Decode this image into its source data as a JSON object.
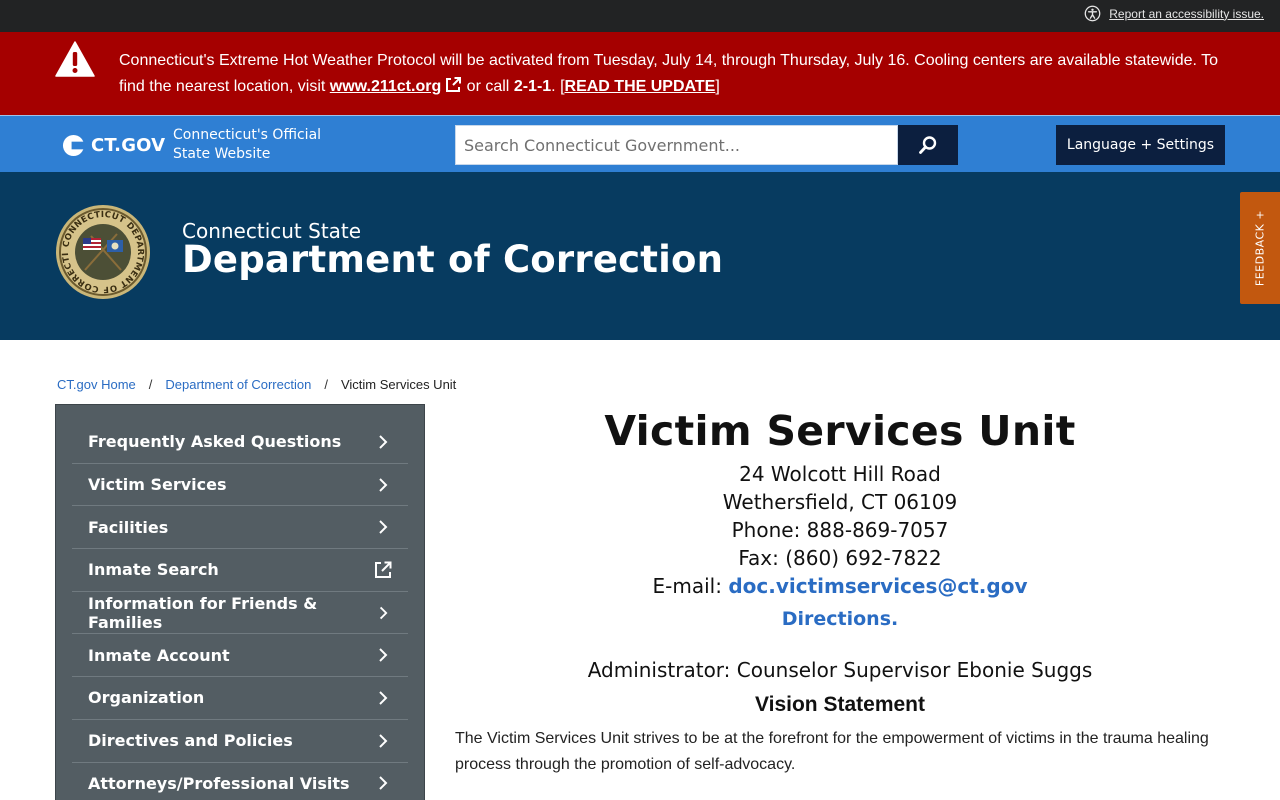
{
  "util": {
    "accessibility_link": "Report an accessibility issue."
  },
  "alert": {
    "text_part1": "Connecticut's Extreme Hot Weather Protocol will be activated from Tuesday, July 14, through Thursday, July 16. Cooling centers are available statewide. To find the nearest location, visit ",
    "link_text": "www.211ct.org",
    "text_part2": " or call ",
    "phone": "2-1-1",
    "text_part3": ". [",
    "update_link": "READ THE UPDATE",
    "text_part4": "]"
  },
  "header": {
    "logo_text": "CT.GOV",
    "subtitle_line1": "Connecticut's Official",
    "subtitle_line2": "State Website",
    "search_placeholder": "Search Connecticut Government...",
    "language_button": "Language + Settings"
  },
  "agency": {
    "pre_title": "Connecticut State",
    "name": "Department of Correction",
    "seal_text": "CONNECTICUT DEPARTMENT OF CORRECTION"
  },
  "feedback": {
    "label": "FEEDBACK +"
  },
  "breadcrumb": [
    "CT.gov Home",
    "Department of Correction",
    "Victim Services Unit"
  ],
  "sidebar": {
    "items": [
      {
        "label": "Frequently Asked Questions",
        "icon": "chevron-right-icon"
      },
      {
        "label": "Victim Services",
        "icon": "chevron-right-icon"
      },
      {
        "label": "Facilities",
        "icon": "chevron-right-icon"
      },
      {
        "label": "Inmate Search",
        "icon": "external-link-icon"
      },
      {
        "label": "Information for Friends & Families",
        "icon": "chevron-right-icon"
      },
      {
        "label": "Inmate Account",
        "icon": "chevron-right-icon"
      },
      {
        "label": "Organization",
        "icon": "chevron-right-icon"
      },
      {
        "label": "Directives and Policies",
        "icon": "chevron-right-icon"
      },
      {
        "label": "Attorneys/Professional Visits",
        "icon": "chevron-right-icon"
      }
    ]
  },
  "main": {
    "title": "Victim Services Unit",
    "address_line1": "24 Wolcott Hill Road",
    "address_line2": "Wethersfield, CT 06109",
    "phone": "Phone: 888-869-7057",
    "fax": "Fax: (860) 692-7822",
    "email_label": "E-mail: ",
    "email": "doc.victimservices@ct.gov",
    "directions": "Directions.",
    "administrator": "Administrator: Counselor Supervisor Ebonie Suggs",
    "vision_heading": "Vision Statement",
    "vision_text": "The Victim Services Unit strives to be at the forefront for the empowerment of victims in the trauma healing process through the promotion of self-advocacy."
  },
  "colors": {
    "alert_red": "#a50000",
    "ctgov_blue": "#2f7fd3",
    "agency_navy": "#073b60",
    "sidebar_gray": "#535d63",
    "link_blue": "#2a6cc3",
    "feedback_orange": "#c2580f"
  }
}
